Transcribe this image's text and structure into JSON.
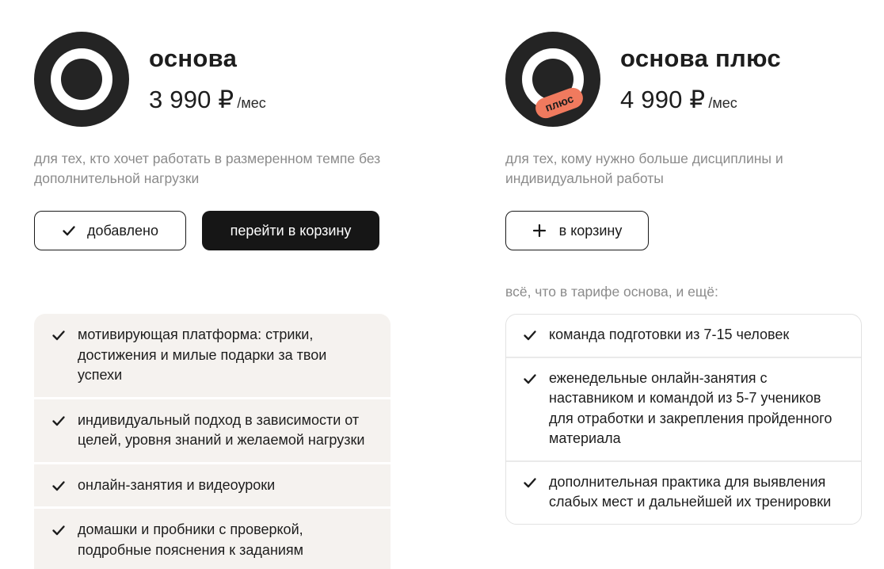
{
  "plans": [
    {
      "name": "основа",
      "price": "3 990 ₽",
      "period": "/мес",
      "description": "для тех, кто хочет работать в размеренном темпе без дополнительной нагрузки",
      "added_label": "добавлено",
      "goto_cart_label": "перейти в корзину",
      "features": [
        "мотивирующая платформа: стрики, достижения и милые подарки за твои успехи",
        "индивидуальный подход в зависимости от целей, уровня знаний и желаемой нагрузки",
        "онлайн-занятия и видеоуроки",
        "домашки и пробники с проверкой, подробные пояснения к заданиям"
      ],
      "icon": "check-icon"
    },
    {
      "name": "основа плюс",
      "badge": "плюс",
      "price": "4 990 ₽",
      "period": "/мес",
      "description": "для тех, кому нужно больше дисциплины и индивидуальной работы",
      "add_to_cart_label": "в корзину",
      "extra_label": "всё, что в тарифе основа, и ещё:",
      "features": [
        "команда подготовки из 7-15 человек",
        "еженедельные онлайн-занятия с наставником и командой из 5-7 учеников для отработки и закрепления пройденного материала",
        "дополнительная практика для выявления слабых мест и дальнейшей их тренировки"
      ],
      "icon": "plus-icon"
    }
  ],
  "colors": {
    "dark": "#1d1d1d",
    "badge": "#f07a5e",
    "feature_bg": "#f5f2ef",
    "muted_text": "#8b8b8b"
  }
}
